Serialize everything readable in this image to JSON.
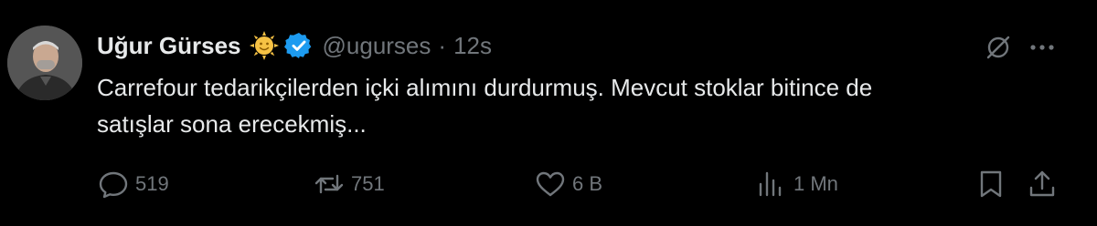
{
  "tweet": {
    "author_name": "Uğur Gürses",
    "name_emoji": "sun-with-face",
    "verified": true,
    "handle": "@ugurses",
    "separator": "·",
    "time": "12s",
    "text_line1": "Carrefour tedarikçilerden içki alımını durdurmuş. Mevcut stoklar bitince de",
    "text_line2": "satışlar sona erecekmiş..."
  },
  "actions": {
    "replies": "519",
    "reposts": "751",
    "likes": "6 B",
    "views": "1 Mn"
  },
  "colors": {
    "background": "#000000",
    "primary_text": "#e7e9ea",
    "secondary_text": "#71767b",
    "verified_blue": "#1d9bf0",
    "emoji_yellow": "#f6c244"
  },
  "icons": {
    "reply": "speech-bubble-icon",
    "repost": "repost-arrows-icon",
    "like": "heart-icon",
    "views": "bar-chart-icon",
    "bookmark": "bookmark-icon",
    "share": "share-upload-icon",
    "grok": "grok-slash-icon",
    "more": "more-dots-icon"
  }
}
